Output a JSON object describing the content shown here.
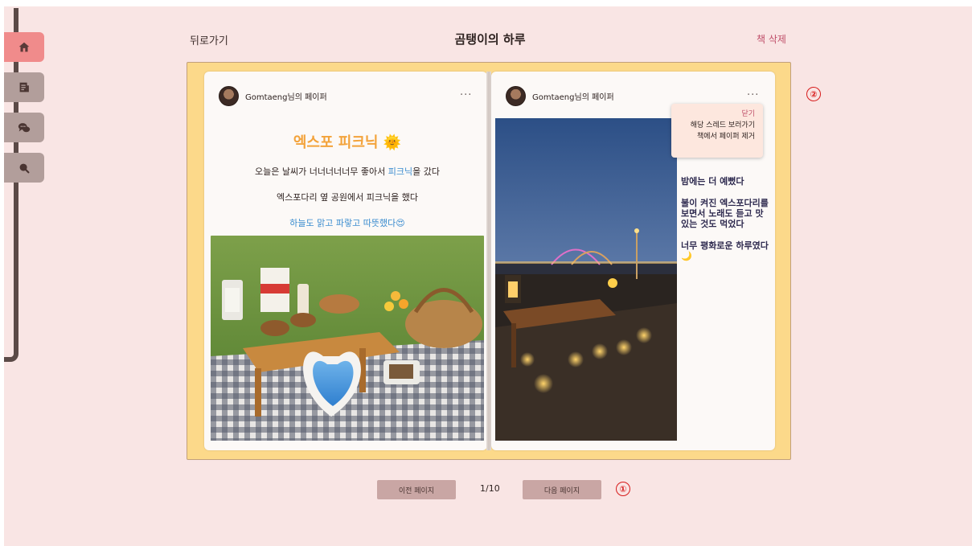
{
  "header": {
    "back_label": "뒤로가기",
    "title": "곰탱이의 하루",
    "delete_label": "책 삭제"
  },
  "nav": {
    "items": [
      {
        "icon": "home-icon",
        "active": true
      },
      {
        "icon": "document-icon",
        "active": false
      },
      {
        "icon": "chat-icon",
        "active": false
      },
      {
        "icon": "search-icon",
        "active": false
      }
    ]
  },
  "pages": {
    "left": {
      "author": "Gomtaeng님의 페이퍼",
      "more": "···",
      "heading": "엑스포 피크닉",
      "heading_emoji": "🌞",
      "line1_pre": "오늘은 날씨가 너너너너너무 좋아서 ",
      "line1_hl": "피크닉",
      "line1_post": "을 갔다",
      "line2": "엑스포다리 옆 공원에서 피크닉을 했다",
      "line3": "하늘도 맑고 파랗고 따뜻했다",
      "line3_emoji": "😍"
    },
    "right": {
      "author": "Gomtaeng님의 페이퍼",
      "more": "···",
      "para1": "밤에는 더 예뻤다",
      "para2": "불이 켜진 엑스포다리를 보면서 노래도 듣고 맛있는 것도 먹었다",
      "para3": "너무 평화로운 하루였다",
      "para3_emoji": "🌙"
    }
  },
  "menu": {
    "close": "닫기",
    "goto_thread": "해당 스레드 보러가기",
    "remove_paper": "책에서 페이퍼 제거"
  },
  "pagination": {
    "prev": "이전 페이지",
    "count": "1/10",
    "next": "다음 페이지"
  },
  "markers": {
    "one": "①",
    "two": "②"
  },
  "colors": {
    "background": "#f9e5e4",
    "book": "#fcd98a",
    "accent_orange": "#f3a33b",
    "accent_blue": "#3a8ccf",
    "delete_pink": "#c0506a",
    "nav_active": "#f08b8b",
    "nav_idle": "#b29e9b"
  }
}
